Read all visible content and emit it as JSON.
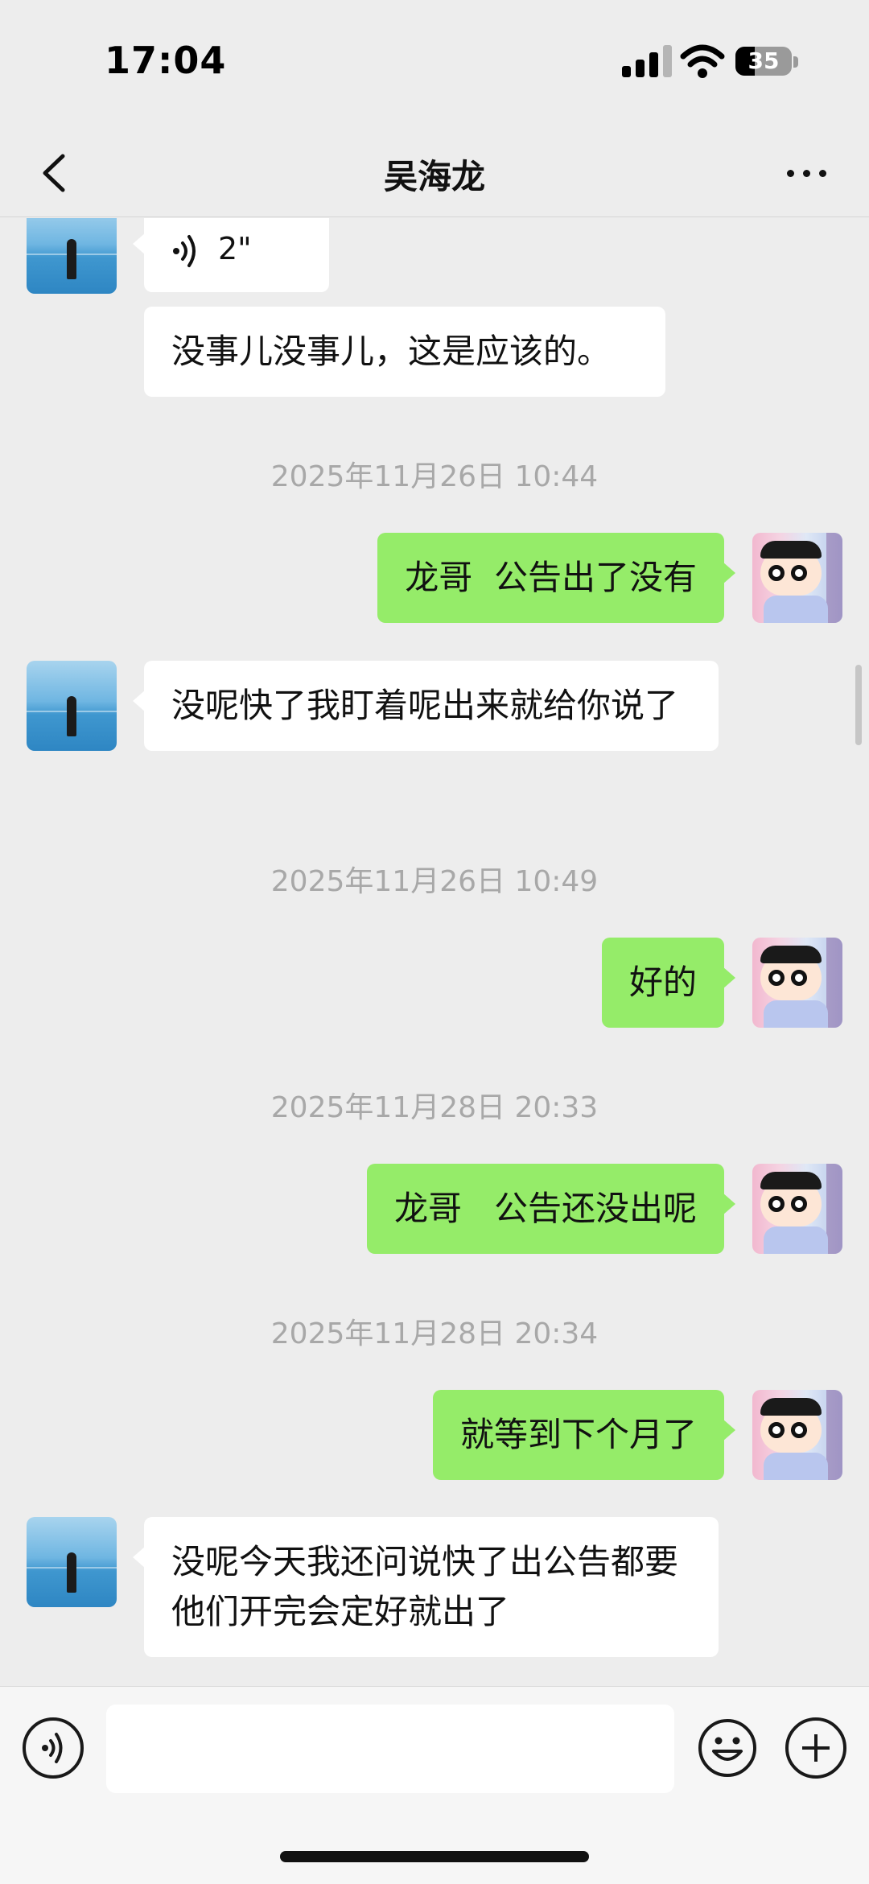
{
  "status_bar": {
    "time": "17:04",
    "battery_level": "35"
  },
  "nav": {
    "title": "吴海龙"
  },
  "messages": [
    {
      "sender": "contact",
      "type": "voice",
      "duration": "2\""
    },
    {
      "sender": "contact",
      "type": "text",
      "text": "没事儿没事儿，这是应该的。"
    },
    {
      "type": "timestamp",
      "text": "2025年11月26日 10:44"
    },
    {
      "sender": "self",
      "type": "text",
      "text": "龙哥  公告出了没有"
    },
    {
      "sender": "contact",
      "type": "text",
      "text": "没呢快了我盯着呢出来就给你说了"
    },
    {
      "type": "timestamp",
      "text": "2025年11月26日 10:49"
    },
    {
      "sender": "self",
      "type": "text",
      "text": "好的"
    },
    {
      "type": "timestamp",
      "text": "2025年11月28日 20:33"
    },
    {
      "sender": "self",
      "type": "text",
      "text": "龙哥   公告还没出呢"
    },
    {
      "type": "timestamp",
      "text": "2025年11月28日 20:34"
    },
    {
      "sender": "self",
      "type": "text",
      "text": "就等到下个月了"
    },
    {
      "sender": "contact",
      "type": "text",
      "text": "没呢今天我还问说快了出公告都要他们开完会定好就出了"
    }
  ],
  "input_bar": {
    "message_value": ""
  },
  "colors": {
    "background": "#ededed",
    "self_bubble": "#95ec69",
    "contact_bubble": "#ffffff",
    "timestamp": "#a8a8a8"
  },
  "icons": [
    "chevron-left-icon",
    "more-icon",
    "voice-icon",
    "emoji-icon",
    "plus-icon",
    "cellular-signal-icon",
    "wifi-icon",
    "battery-icon"
  ]
}
